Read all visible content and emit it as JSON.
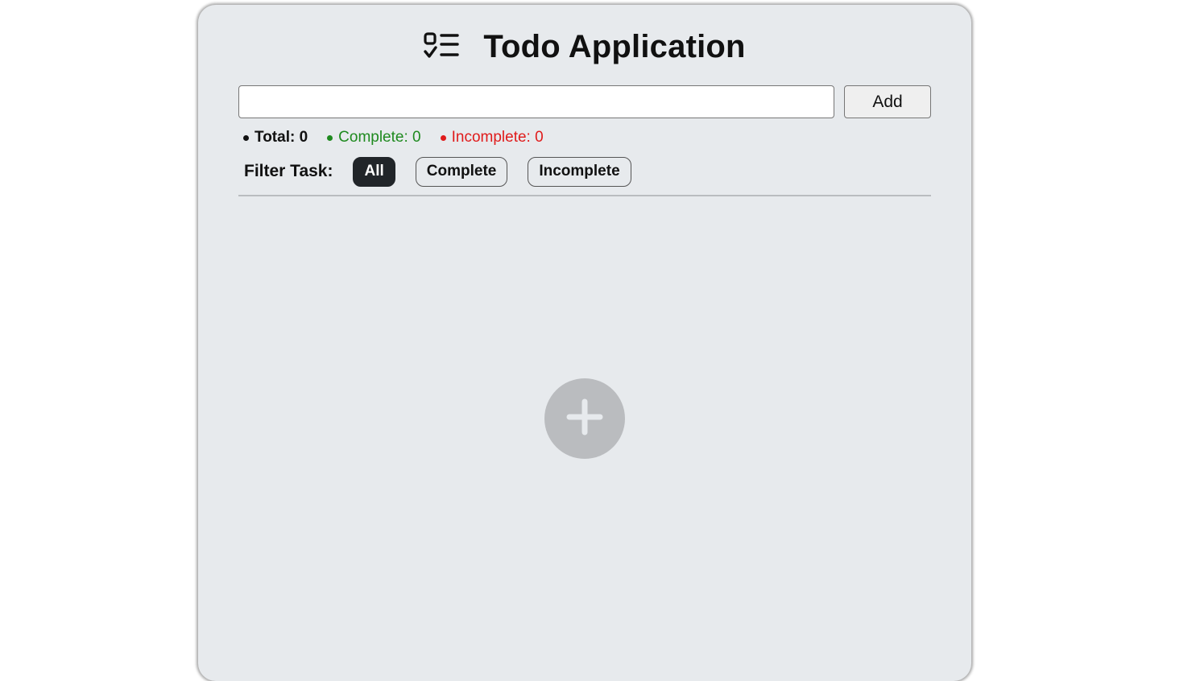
{
  "header": {
    "icon": "checklist-icon",
    "title": "Todo Application"
  },
  "task_form": {
    "input_value": "",
    "input_placeholder": "",
    "add_label": "Add"
  },
  "stats": {
    "total_label": "Total: 0",
    "complete_label": "Complete: 0",
    "incomplete_label": "Incomplete: 0",
    "colors": {
      "total": "#111111",
      "complete": "#1f8a1f",
      "incomplete": "#e01b1b"
    }
  },
  "filter": {
    "label": "Filter Task:",
    "options": [
      "All",
      "Complete",
      "Incomplete"
    ],
    "selected": "All"
  },
  "empty_state": {
    "icon": "plus-icon"
  }
}
